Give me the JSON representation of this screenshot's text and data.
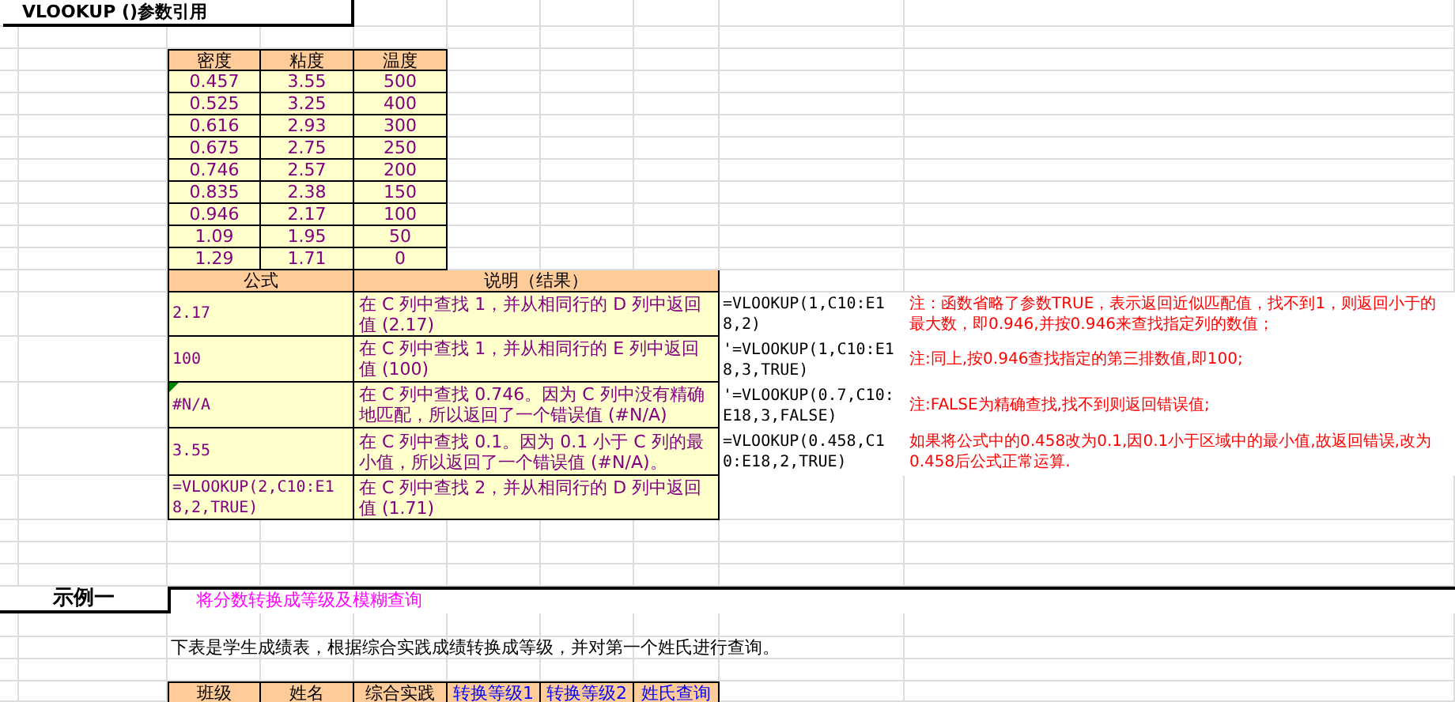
{
  "sheet_title": "VLOOKUP ()参数引用",
  "lookup_table": {
    "columns": [
      "密度",
      "粘度",
      "温度"
    ],
    "rows": [
      [
        "0.457",
        "3.55",
        "500"
      ],
      [
        "0.525",
        "3.25",
        "400"
      ],
      [
        "0.616",
        "2.93",
        "300"
      ],
      [
        "0.675",
        "2.75",
        "250"
      ],
      [
        "0.746",
        "2.57",
        "200"
      ],
      [
        "0.835",
        "2.38",
        "150"
      ],
      [
        "0.946",
        "2.17",
        "100"
      ],
      [
        "1.09",
        "1.95",
        "50"
      ],
      [
        "1.29",
        "1.71",
        "0"
      ]
    ]
  },
  "examples": {
    "columns": [
      "公式",
      "说明（结果）"
    ],
    "rows": [
      {
        "result": "2.17",
        "explanation": "在 C 列中查找 1，并从相同行的 D 列中返回值 (2.17)",
        "formula": "=VLOOKUP(1,C10:E18,2)",
        "note": "注：函数省略了参数TRUE，表示返回近似匹配值，找不到1，则返回小于的最大数，即0.946,并按0.946来查找指定列的数值；",
        "error_flag": false
      },
      {
        "result": "100",
        "explanation": "在 C 列中查找 1，并从相同行的 E 列中返回值 (100)",
        "formula": "'=VLOOKUP(1,C10:E18,3,TRUE)",
        "note": "注:同上,按0.946查找指定的第三排数值,即100;",
        "error_flag": false
      },
      {
        "result": "#N/A",
        "explanation": "在 C 列中查找 0.746。因为 C 列中没有精确地匹配，所以返回了一个错误值 (#N/A)",
        "formula": "'=VLOOKUP(0.7,C10:E18,3,FALSE)",
        "note": "注:FALSE为精确查找,找不到则返回错误值;",
        "error_flag": true
      },
      {
        "result": "3.55",
        "explanation": "在 C 列中查找 0.1。因为 0.1 小于 C 列的最小值，所以返回了一个错误值 (#N/A)。",
        "formula": "=VLOOKUP(0.458,C10:E18,2,TRUE)",
        "note": "如果将公式中的0.458改为0.1,因0.1小于区域中的最小值,故返回错误,改为0.458后公式正常运算.",
        "error_flag": false
      },
      {
        "result": "=VLOOKUP(2,C10:E18,2,TRUE)",
        "explanation": "在 C 列中查找 2，并从相同行的 D 列中返回值 (1.71)",
        "error_flag": false
      }
    ]
  },
  "example_1": {
    "label": "示例一",
    "subtitle": "将分数转换成等级及模糊查询",
    "description": "下表是学生成绩表，根据综合实践成绩转换成等级，并对第一个姓氏进行查询。",
    "columns": [
      {
        "label": "班级",
        "highlight": false
      },
      {
        "label": "姓名",
        "highlight": false
      },
      {
        "label": "综合实践",
        "highlight": false
      },
      {
        "label": "转换等级1",
        "highlight": true
      },
      {
        "label": "转换等级2",
        "highlight": true
      },
      {
        "label": "姓氏查询",
        "highlight": true
      }
    ]
  }
}
